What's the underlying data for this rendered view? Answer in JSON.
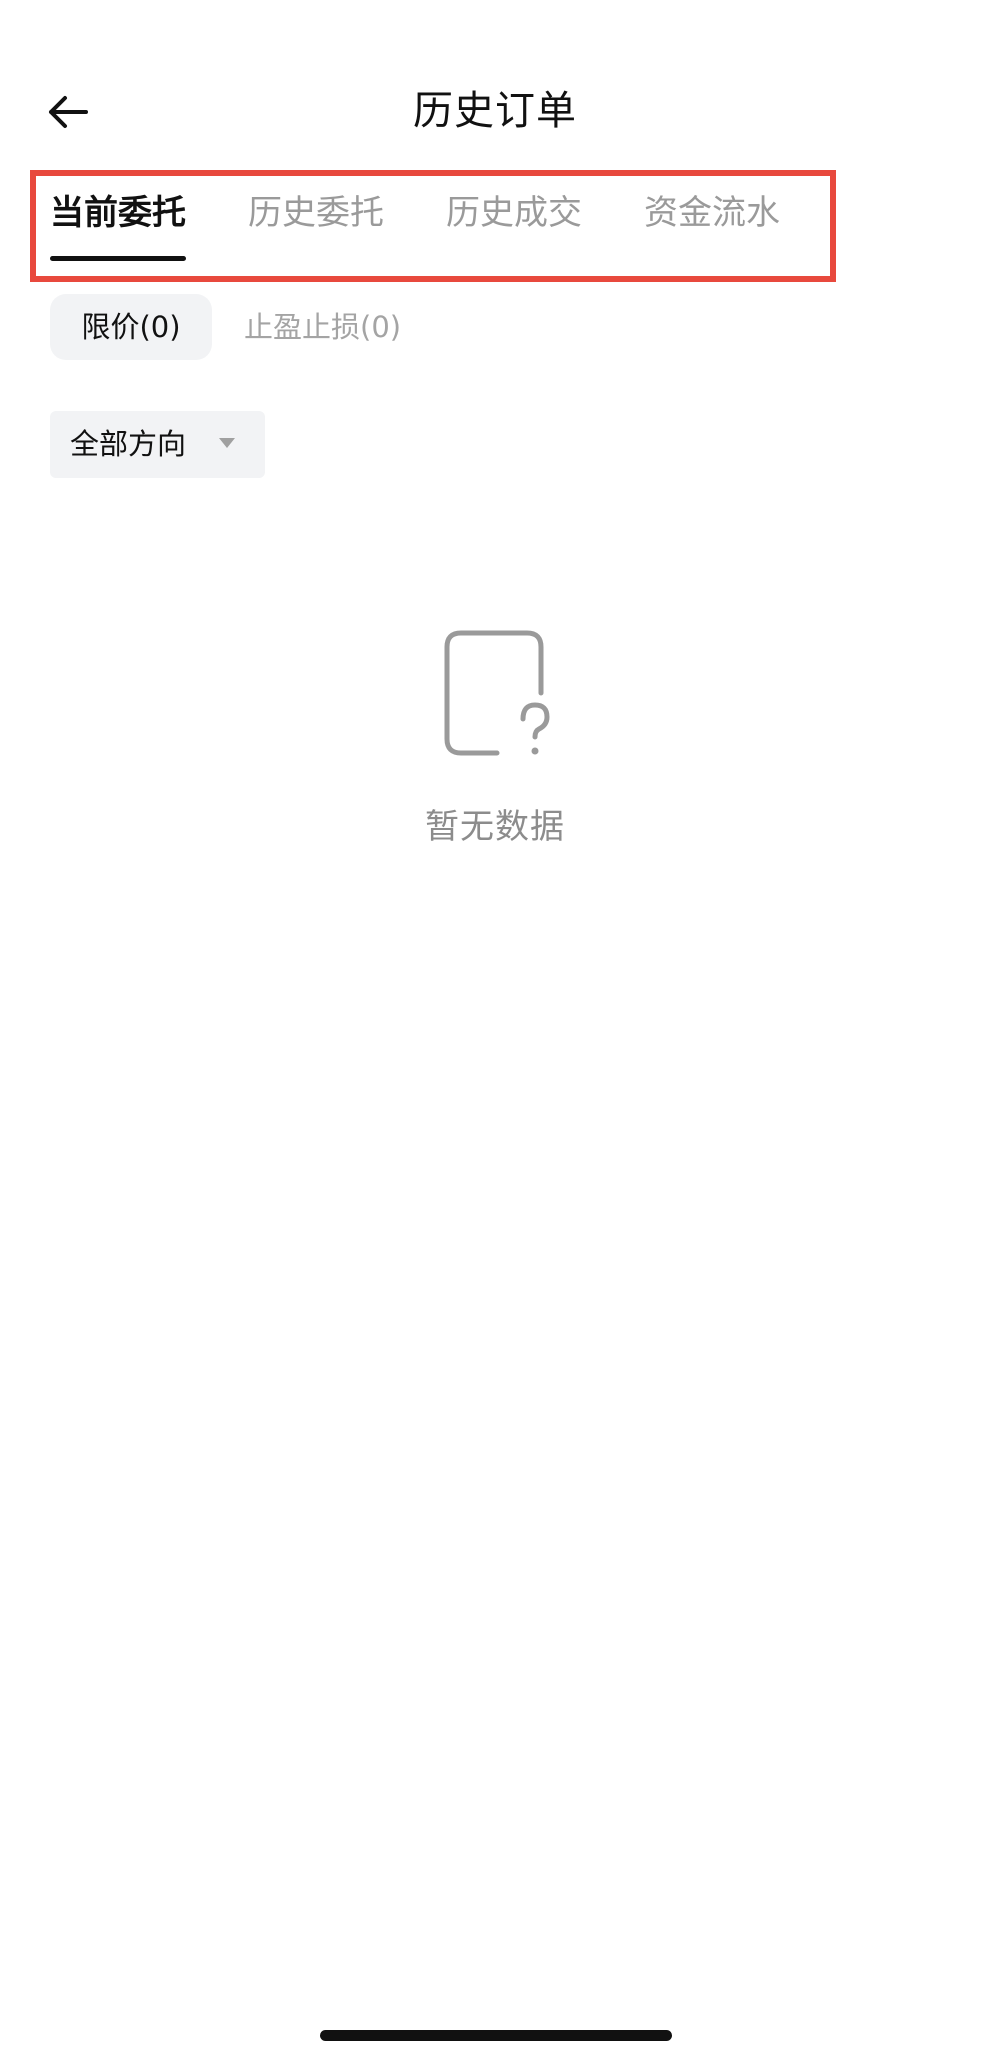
{
  "header": {
    "title": "历史订单",
    "back_icon": "arrow-left-icon"
  },
  "tabs": [
    {
      "label": "当前委托",
      "active": true
    },
    {
      "label": "历史委托",
      "active": false
    },
    {
      "label": "历史成交",
      "active": false
    },
    {
      "label": "资金流水",
      "active": false
    }
  ],
  "subtabs": [
    {
      "label": "限价(0)",
      "active": true
    },
    {
      "label": "止盈止损(0)",
      "active": false
    }
  ],
  "filter": {
    "direction_label": "全部方向",
    "caret_icon": "caret-down-icon"
  },
  "empty_state": {
    "icon": "empty-document-question-icon",
    "text": "暂无数据"
  },
  "colors": {
    "highlight_border": "#e8493d",
    "active_text": "#111111",
    "inactive_text": "#9a9a9a",
    "chip_bg": "#f2f3f5"
  }
}
